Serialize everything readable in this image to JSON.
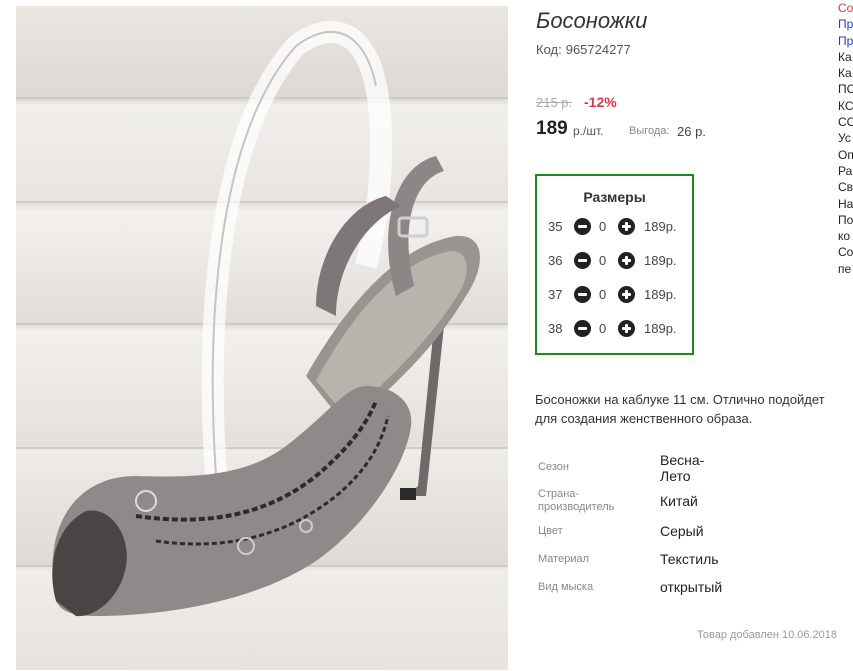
{
  "product": {
    "title": "Босоножки",
    "code_label": "Код:",
    "code": "965724277",
    "old_price": "215 р.",
    "discount": "-12%",
    "price": "189",
    "price_unit": "р./шт.",
    "benefit_label": "Выгода:",
    "benefit_value": "26 р."
  },
  "sizes": {
    "title": "Размеры",
    "rows": [
      {
        "size": "35",
        "qty": "0",
        "price": "189р."
      },
      {
        "size": "36",
        "qty": "0",
        "price": "189р."
      },
      {
        "size": "37",
        "qty": "0",
        "price": "189р."
      },
      {
        "size": "38",
        "qty": "0",
        "price": "189р."
      }
    ]
  },
  "description": {
    "line1": "Босоножки на каблуке 11 см. Отлично подойдет",
    "line2": "для создания женственного образа."
  },
  "attributes": [
    {
      "label": "Сезон",
      "value": "Весна-Лето",
      "value_lines": [
        "Весна-",
        "Лето"
      ]
    },
    {
      "label": "Страна-производитель",
      "label_lines": [
        "Страна-",
        "производитель"
      ],
      "value": "Китай"
    },
    {
      "label": "Цвет",
      "value": "Серый"
    },
    {
      "label": "Материал",
      "value": "Текстиль"
    },
    {
      "label": "Вид мыска",
      "value": "открытый"
    }
  ],
  "added_text": "Товар добавлен 10.06.2018",
  "sidebar_truncated": [
    {
      "text": "Со",
      "style": "red"
    },
    {
      "text": "Пр",
      "style": "link"
    },
    {
      "text": "Пр",
      "style": "link"
    },
    {
      "text": "Ка",
      "style": "normal"
    },
    {
      "text": "Ка",
      "style": "normal"
    },
    {
      "text": "ПС",
      "style": "normal"
    },
    {
      "text": "КС",
      "style": "normal"
    },
    {
      "text": "СС",
      "style": "normal"
    },
    {
      "text": "Ус",
      "style": "normal"
    },
    {
      "text": "Оп",
      "style": "normal"
    },
    {
      "text": "Ра",
      "style": "normal"
    },
    {
      "text": "Св",
      "style": "normal"
    },
    {
      "text": "На",
      "style": "normal"
    },
    {
      "text": "По",
      "style": "normal"
    },
    {
      "text": "ко",
      "style": "normal"
    },
    {
      "text": "Со",
      "style": "normal"
    },
    {
      "text": "пе",
      "style": "normal"
    }
  ],
  "colors": {
    "accent_green": "#1e8a1e",
    "discount_red": "#d9374d",
    "link_blue": "#1e3fc9"
  }
}
